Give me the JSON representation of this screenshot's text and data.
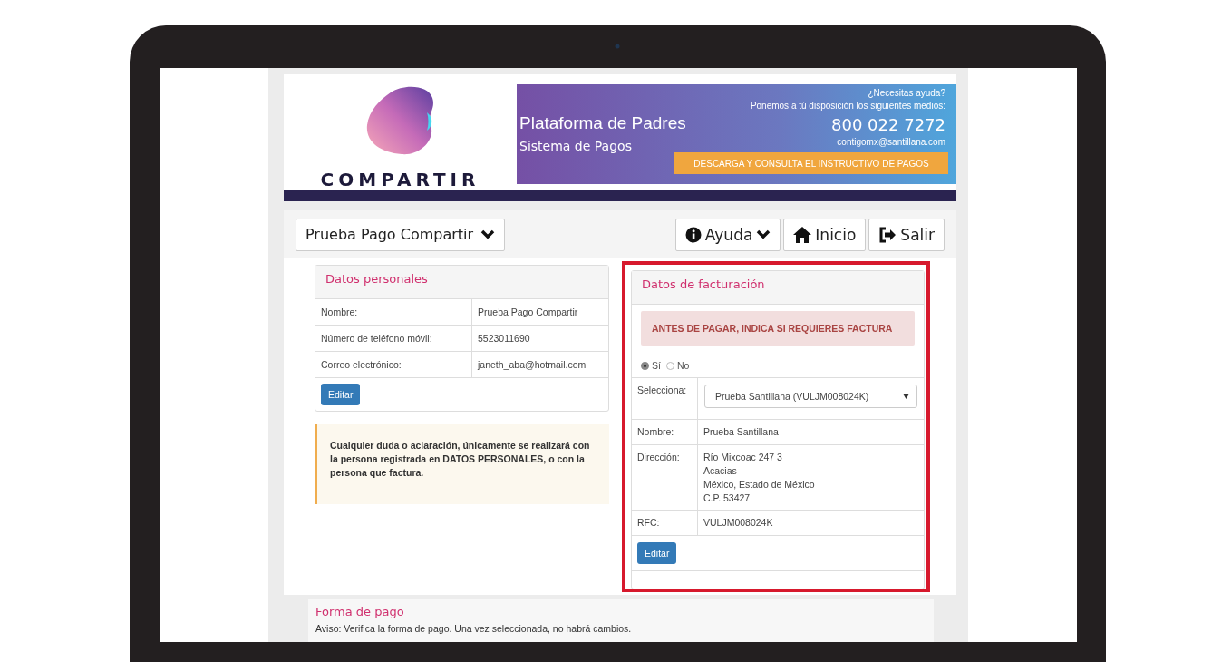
{
  "header": {
    "logo_text": "COMPARTIR",
    "banner": {
      "title": "Plataforma de Padres",
      "subtitle": "Sistema de Pagos",
      "help_question": "¿Necesitas ayuda?",
      "help_text": "Ponemos a tú disposición los siguientes medios:",
      "phone": "800 022 7272",
      "email": "contigomx@santillana.com",
      "download_button": "DESCARGA Y CONSULTA EL INSTRUCTIVO DE PAGOS"
    }
  },
  "nav": {
    "user_menu": "Prueba Pago Compartir",
    "buttons": [
      {
        "kind": "help",
        "label": "Ayuda"
      },
      {
        "kind": "home",
        "label": "Inicio"
      },
      {
        "kind": "logout",
        "label": "Salir"
      }
    ]
  },
  "personal": {
    "title": "Datos personales",
    "rows": [
      {
        "label": "Nombre:",
        "value": "Prueba Pago Compartir"
      },
      {
        "label": "Número de teléfono móvil:",
        "value": "5523011690"
      },
      {
        "label": "Correo electrónico:",
        "value": "janeth_aba@hotmail.com"
      }
    ],
    "edit_button": "Editar"
  },
  "notice": "Cualquier duda o aclaración, únicamente se realizará con la persona registrada en DATOS PERSONALES, o con la persona que factura.",
  "billing": {
    "highlighted": true,
    "title": "Datos de facturación",
    "alert": "ANTES DE PAGAR, INDICA SI REQUIERES FACTURA",
    "options": [
      {
        "label": "Sí",
        "selected": true
      },
      {
        "label": "No",
        "selected": false
      }
    ],
    "select_label": "Selecciona:",
    "select_value": "Prueba Santillana (VULJM008024K)",
    "rows": [
      {
        "label": "Nombre:",
        "lines": [
          "Prueba Santillana"
        ]
      },
      {
        "label": "Dirección:",
        "lines": [
          "Río Mixcoac 247 3",
          "Acacias",
          "México, Estado de México",
          "C.P. 53427"
        ]
      },
      {
        "label": "RFC:",
        "lines": [
          "VULJM008024K"
        ]
      }
    ],
    "edit_button": "Editar"
  },
  "payment": {
    "title": "Forma de pago",
    "notice": "Aviso: Verifica la forma de pago. Una vez seleccionada, no habrá cambios."
  }
}
